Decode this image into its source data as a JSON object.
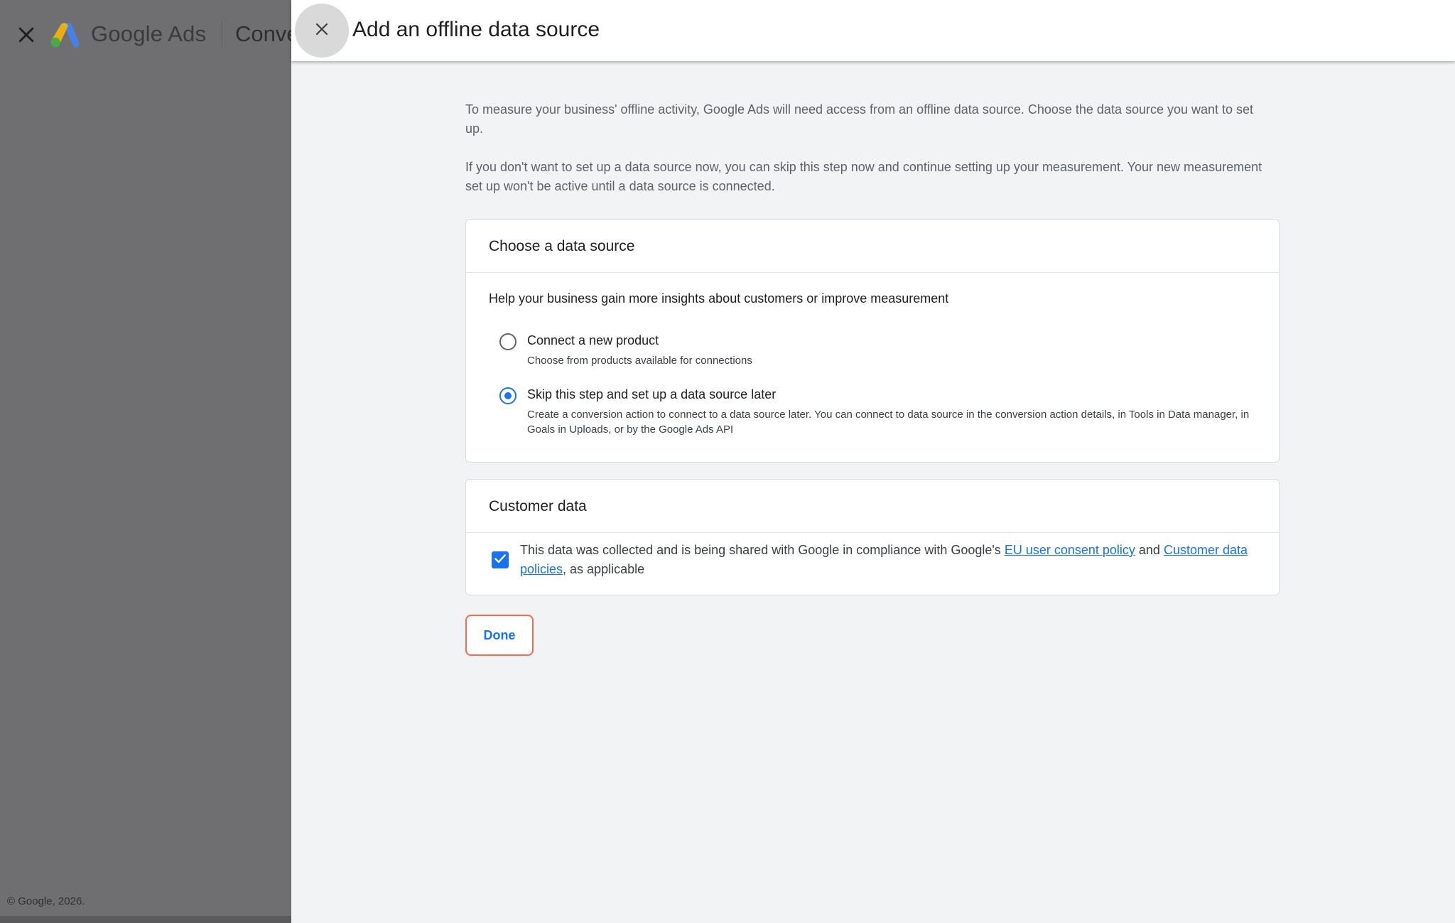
{
  "background": {
    "brand": "Google Ads",
    "section_title": "Conve",
    "footer": "© Google, 2026."
  },
  "dialog": {
    "title": "Add an offline data source",
    "intro_1": "To measure your business' offline activity, Google Ads will need access from an offline data source. Choose the data source you want to set up.",
    "intro_2": "If you don't want to set up a data source now, you can skip this step now and continue setting up your measurement. Your new measurement set up won't be active until a data source is connected.",
    "source_card": {
      "title": "Choose a data source",
      "subhead": "Help your business gain more insights about customers or improve measurement",
      "options": [
        {
          "label": "Connect a new product",
          "description": "Choose from products available for connections",
          "selected": false
        },
        {
          "label": "Skip this step and set up a data source later",
          "description": "Create a conversion action to connect to a data source later. You can connect to data source in the conversion action details, in Tools in Data manager, in Goals in Uploads, or by the Google Ads API",
          "selected": true
        }
      ]
    },
    "customer_card": {
      "title": "Customer data",
      "checked": true,
      "consent_prefix": "This data was collected and is being shared with Google in compliance with Google's ",
      "link_1": "EU user consent policy",
      "consent_middle": " and ",
      "link_2": "Customer data policies",
      "consent_suffix": ", as applicable"
    },
    "done_label": "Done"
  },
  "colors": {
    "accent": "#1a73e8",
    "focus_outline": "#f26c4f",
    "scrim": "#6f6f71"
  }
}
